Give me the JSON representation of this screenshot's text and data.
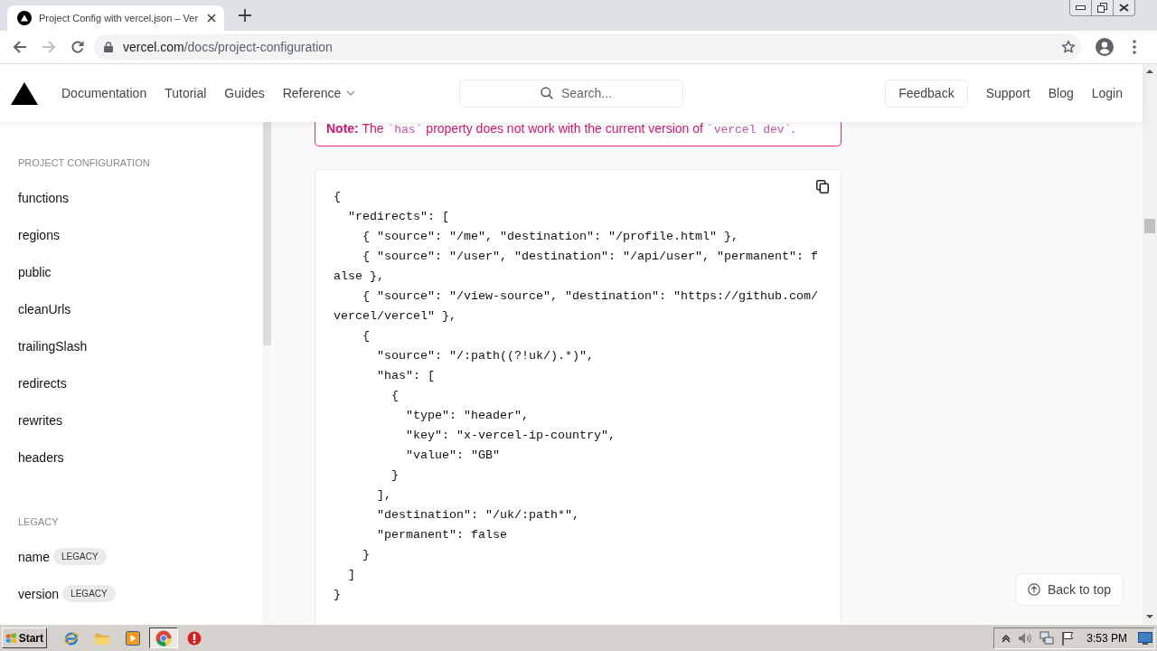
{
  "browser": {
    "tab": {
      "title": "Project Config with vercel.json – Ver"
    },
    "nav_buttons": [
      {
        "kind": "back",
        "disabled": false
      },
      {
        "kind": "forward",
        "disabled": true
      },
      {
        "kind": "reload",
        "disabled": false
      }
    ],
    "address": {
      "host": "vercel.com",
      "path": "/docs/project-configuration"
    }
  },
  "site_header": {
    "nav": [
      {
        "label": "Documentation",
        "dropdown": false
      },
      {
        "label": "Tutorial",
        "dropdown": false
      },
      {
        "label": "Guides",
        "dropdown": false
      },
      {
        "label": "Reference",
        "dropdown": true
      }
    ],
    "search": {
      "placeholder": "Search..."
    },
    "feedback": "Feedback",
    "links": [
      "Support",
      "Blog",
      "Login"
    ]
  },
  "sidebar": {
    "sections": [
      {
        "title": "PROJECT CONFIGURATION",
        "items": [
          {
            "label": "functions"
          },
          {
            "label": "regions"
          },
          {
            "label": "public"
          },
          {
            "label": "cleanUrls"
          },
          {
            "label": "trailingSlash"
          },
          {
            "label": "redirects"
          },
          {
            "label": "rewrites"
          },
          {
            "label": "headers"
          }
        ]
      },
      {
        "title": "LEGACY",
        "items": [
          {
            "label": "name",
            "badge": "LEGACY"
          },
          {
            "label": "version",
            "badge": "LEGACY"
          }
        ]
      }
    ]
  },
  "note": {
    "parts": [
      {
        "kind": "bold",
        "text": "Note:"
      },
      {
        "kind": "text",
        "text": " The "
      },
      {
        "kind": "code",
        "text": "`has`"
      },
      {
        "kind": "text",
        "text": " property does not work with the current version of "
      },
      {
        "kind": "code",
        "text": "`vercel dev`"
      },
      {
        "kind": "text",
        "text": "."
      }
    ]
  },
  "code_block": {
    "lines": [
      "{",
      "  \"redirects\": [",
      "    { \"source\": \"/me\", \"destination\": \"/profile.html\" },",
      "    { \"source\": \"/user\", \"destination\": \"/api/user\", \"permanent\": false },",
      "    { \"source\": \"/view-source\", \"destination\": \"https://github.com/vercel/vercel\" },",
      "    {",
      "      \"source\": \"/:path((?!uk/).*)\",",
      "      \"has\": [",
      "        {",
      "          \"type\": \"header\",",
      "          \"key\": \"x-vercel-ip-country\",",
      "          \"value\": \"GB\"",
      "        }",
      "      ],",
      "      \"destination\": \"/uk/:path*\",",
      "      \"permanent\": false",
      "    }",
      "  ]",
      "}"
    ]
  },
  "back_to_top": "Back to top",
  "taskbar": {
    "start": "Start",
    "apps": [
      {
        "kind": "e-browser",
        "selected": false
      },
      {
        "kind": "folder",
        "selected": false
      },
      {
        "kind": "media",
        "selected": false
      },
      {
        "kind": "browser",
        "selected": true
      },
      {
        "kind": "alert",
        "selected": false
      }
    ],
    "clock": "3:53 PM"
  }
}
